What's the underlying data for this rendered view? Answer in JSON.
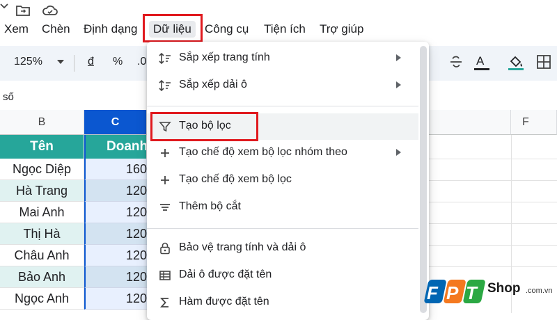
{
  "menubar": {
    "items": [
      {
        "label": "Xem"
      },
      {
        "label": "Chèn"
      },
      {
        "label": "Định dạng"
      },
      {
        "label": "Dữ liệu"
      },
      {
        "label": "Công cụ"
      },
      {
        "label": "Tiện ích"
      },
      {
        "label": "Trợ giúp"
      }
    ],
    "active": "Dữ liệu"
  },
  "toolbar": {
    "zoom": "125%",
    "currency": "đ",
    "percent": "%",
    "decimal": ".0",
    "text_color": "A",
    "icons": [
      "strikethrough-icon",
      "text-color-icon",
      "fill-color-icon",
      "borders-icon"
    ],
    "fill_accent": "#26a69a"
  },
  "formula_bar": {
    "cell_text": "số"
  },
  "grid": {
    "columns": [
      "B",
      "C",
      "F"
    ],
    "selected_column": "C",
    "header_row": {
      "b": "Tên",
      "c": "Doanh"
    },
    "rows": [
      {
        "name": "Ngọc Diệp",
        "value": "160"
      },
      {
        "name": "Hà Trang",
        "value": "120"
      },
      {
        "name": "Mai Anh",
        "value": "120"
      },
      {
        "name": "Thị Hà",
        "value": "120"
      },
      {
        "name": "Châu Anh",
        "value": "120"
      },
      {
        "name": "Bảo Anh",
        "value": "120"
      },
      {
        "name": "Ngọc Anh",
        "value": "120"
      }
    ],
    "header_color": "#26a69a"
  },
  "dropdown": {
    "items": [
      {
        "label": "Sắp xếp trang tính",
        "icon": "sort-icon",
        "submenu": true
      },
      {
        "label": "Sắp xếp dải ô",
        "icon": "sort-icon",
        "submenu": true
      },
      {
        "label": "Tạo bộ lọc",
        "icon": "filter-icon",
        "submenu": false
      },
      {
        "label": "Tạo chế độ xem bộ lọc nhóm theo",
        "icon": "plus-icon",
        "submenu": true
      },
      {
        "label": "Tạo chế độ xem bộ lọc",
        "icon": "plus-icon",
        "submenu": false
      },
      {
        "label": "Thêm bộ cắt",
        "icon": "slicer-icon",
        "submenu": false
      },
      {
        "label": "Bảo vệ trang tính và dải ô",
        "icon": "lock-icon",
        "submenu": false
      },
      {
        "label": "Dải ô được đặt tên",
        "icon": "named-range-icon",
        "submenu": false
      },
      {
        "label": "Hàm được đặt tên",
        "icon": "sigma-icon",
        "submenu": false
      }
    ],
    "highlighted": "Tạo bộ lọc"
  },
  "logo": {
    "brand": "FPT",
    "shop": "Shop",
    "domain": ".com.vn",
    "colors": {
      "blue": "#0066b3",
      "orange": "#f47920",
      "green": "#2ba843"
    }
  }
}
